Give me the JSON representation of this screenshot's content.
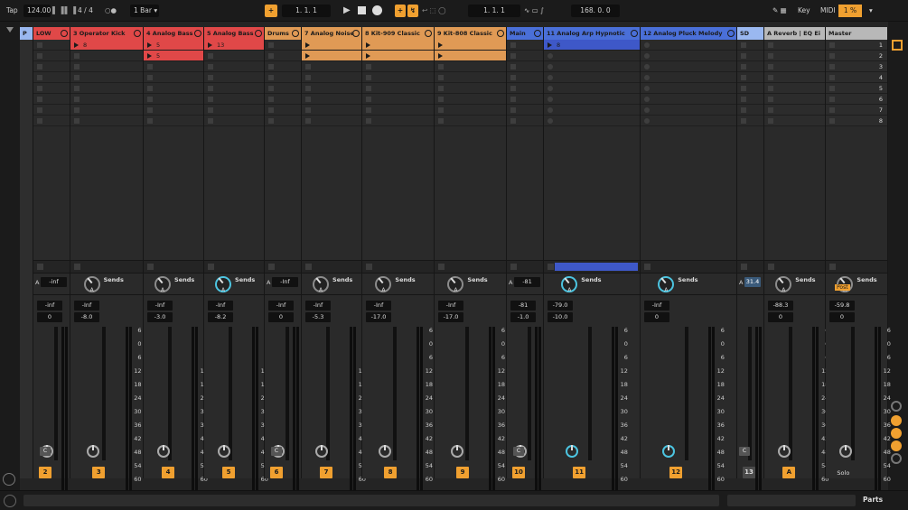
{
  "transport": {
    "tap_label": "Tap",
    "tempo": "124.00",
    "nudge_icon": "nudge-icon",
    "time_signature": "4 / 4",
    "metronome_icon": "metronome-icon",
    "quantization": "1 Bar",
    "follow_label": "+",
    "arrangement_position": "1.  1.  1",
    "loop_start": "1.  1.  1",
    "loop_length": "168.  0.  0",
    "key_label": "Key",
    "midi_label": "MIDI",
    "cpu": "1 %",
    "play_icon": "play-icon",
    "stop_icon": "stop-icon",
    "record_icon": "record-icon"
  },
  "tracks": [
    {
      "name": "LOW",
      "color": "#e04848",
      "clips": [
        "",
        ""
      ],
      "vol": "-inf",
      "pan": "0",
      "num": "2",
      "group": true
    },
    {
      "name": "3 Operator Kick",
      "color": "#e04848",
      "clips": [
        "8",
        ""
      ],
      "vol": "-Inf",
      "pan": "-8.0",
      "num": "3"
    },
    {
      "name": "4 Analog Bass",
      "color": "#e04848",
      "clips": [
        "5",
        "5"
      ],
      "vol": "-Inf",
      "pan": "-3.0",
      "num": "4"
    },
    {
      "name": "5 Analog Bass",
      "color": "#e04848",
      "clips": [
        "13",
        ""
      ],
      "vol": "-Inf",
      "pan": "-8.2",
      "num": "5"
    },
    {
      "name": "Drums",
      "color": "#e09a55",
      "clips": [
        "",
        ""
      ],
      "vol": "-Inf",
      "pan": "0",
      "num": "6",
      "group": true
    },
    {
      "name": "7 Analog Noise",
      "color": "#e09a55",
      "clips": [
        "",
        ""
      ],
      "vol": "-Inf",
      "pan": "-5.3",
      "num": "7"
    },
    {
      "name": "8 Kit-909 Classic",
      "color": "#e09a55",
      "clips": [
        "",
        ""
      ],
      "vol": "-Inf",
      "pan": "-17.0",
      "num": "8"
    },
    {
      "name": "9 Kit-808 Classic",
      "color": "#e09a55",
      "clips": [
        "",
        ""
      ],
      "vol": "-Inf",
      "pan": "-17.0",
      "num": "9"
    },
    {
      "name": "Main",
      "color": "#4a6fd8",
      "clips": [
        "",
        ""
      ],
      "vol": "-81",
      "pan": "-1.0",
      "num": "10",
      "group": true
    },
    {
      "name": "11 Analog Arp Hypnotic",
      "color": "#4a6fd8",
      "clips": [
        "8",
        ""
      ],
      "vol": "-79.0",
      "pan": "-10.0",
      "num": "11"
    },
    {
      "name": "12 Analog Pluck Melody",
      "color": "#4a6fd8",
      "clips": [
        "",
        ""
      ],
      "vol": "-Inf",
      "pan": "0",
      "num": "12"
    },
    {
      "name": "SD",
      "color": "#9ab8f0",
      "clips": [
        "",
        ""
      ],
      "vol": "31.4",
      "pan": "",
      "num": "13",
      "group": true
    },
    {
      "name": "A Reverb | EQ Ei",
      "color": "#b8b8b8",
      "clips": [
        "",
        ""
      ],
      "vol": "-88.3",
      "pan": "0",
      "num": "A"
    },
    {
      "name": "Master",
      "color": "#b8b8b8",
      "clips": [
        "",
        ""
      ],
      "vol": "-59.8",
      "pan": "0",
      "num": ""
    }
  ],
  "mixer": {
    "sends_label": "Sends",
    "post_label": "Post",
    "solo_label": "Solo",
    "scale": [
      "6",
      "0",
      "6",
      "12",
      "18",
      "24",
      "30",
      "36",
      "42",
      "48",
      "54",
      "60"
    ],
    "s_label": "S",
    "c_label": "C",
    "a_label": "A"
  },
  "scenes": [
    "1",
    "2",
    "3",
    "4",
    "5",
    "6",
    "7",
    "8"
  ],
  "bottom": {
    "parts_label": "Parts"
  }
}
